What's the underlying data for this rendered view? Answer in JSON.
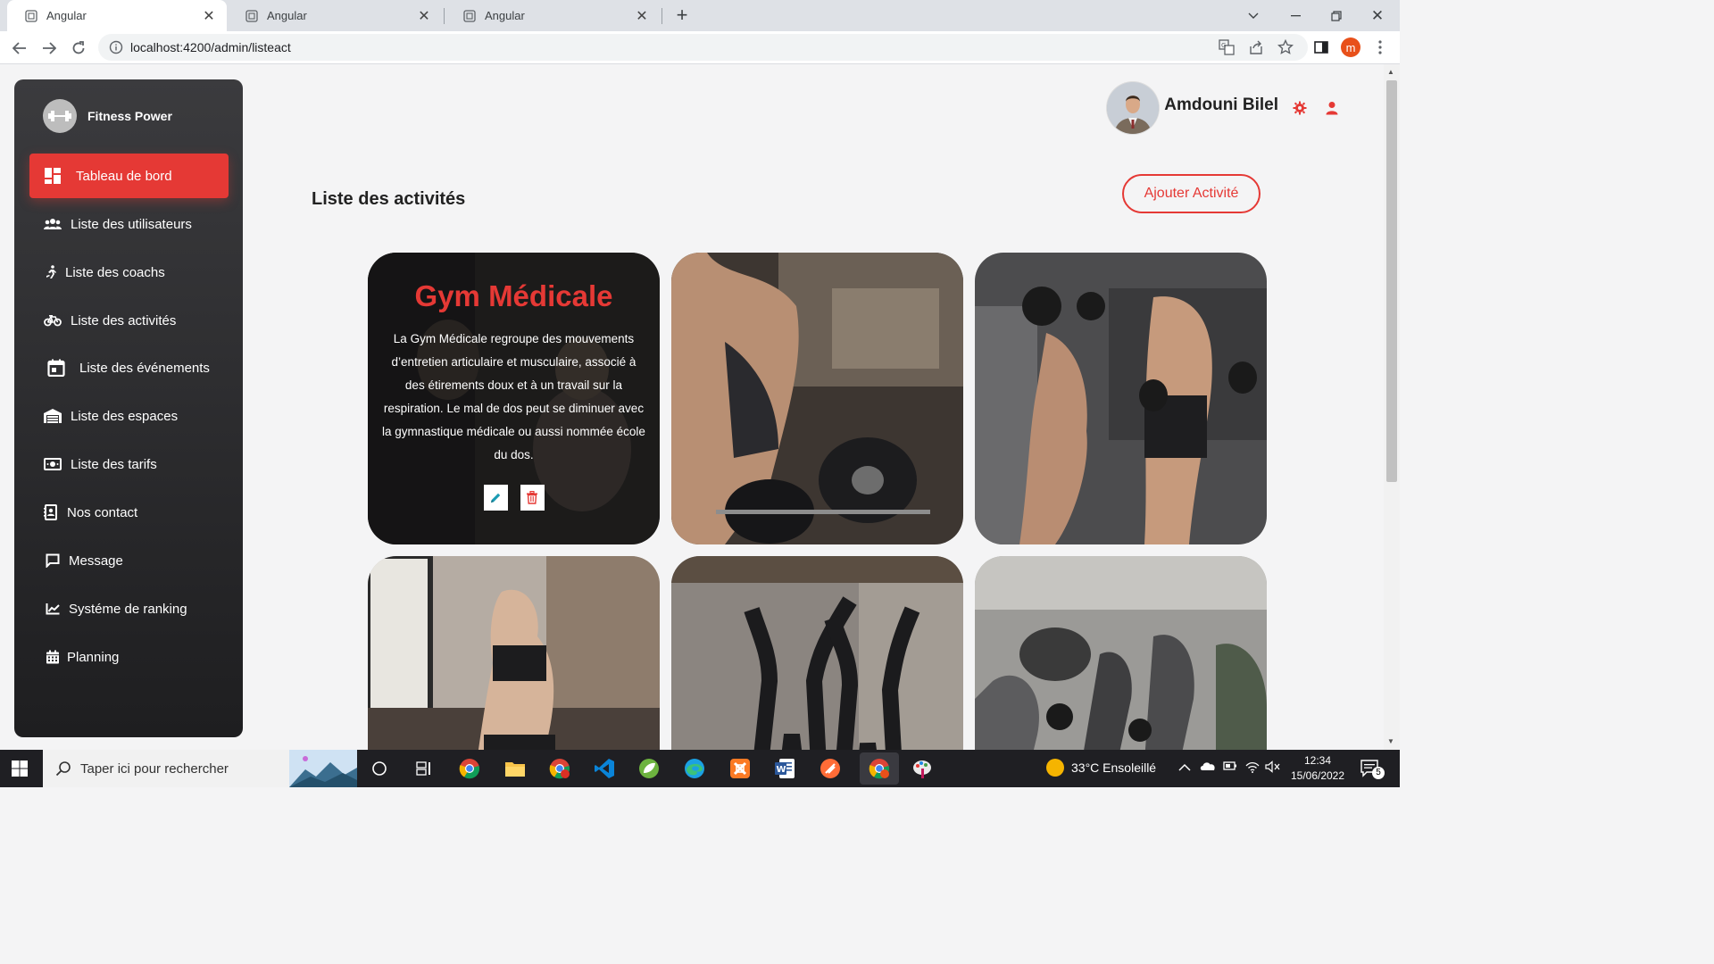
{
  "browser": {
    "tabs": [
      {
        "title": "Angular",
        "active": true
      },
      {
        "title": "Angular",
        "active": false
      },
      {
        "title": "Angular",
        "active": false
      }
    ],
    "url": "localhost:4200/admin/listeact",
    "profile_initial": "m"
  },
  "sidebar": {
    "brand": "Fitness Power",
    "items": [
      {
        "label": "Tableau de bord",
        "icon": "dashboard-icon",
        "active": true
      },
      {
        "label": "Liste des utilisateurs",
        "icon": "users-icon"
      },
      {
        "label": "Liste des coachs",
        "icon": "running-icon"
      },
      {
        "label": "Liste des activités",
        "icon": "bicycle-icon"
      },
      {
        "label": "Liste des événements",
        "icon": "calendar-icon"
      },
      {
        "label": "Liste des espaces",
        "icon": "warehouse-icon"
      },
      {
        "label": "Liste des tarifs",
        "icon": "money-icon"
      },
      {
        "label": "Nos contact",
        "icon": "contact-book-icon"
      },
      {
        "label": "Message",
        "icon": "message-icon"
      },
      {
        "label": "Systéme de ranking",
        "icon": "chart-line-icon"
      },
      {
        "label": "Planning",
        "icon": "calendar-grid-icon"
      }
    ]
  },
  "header": {
    "username": "Amdouni Bilel"
  },
  "main": {
    "title": "Liste des activités",
    "add_button": "Ajouter Activité",
    "featured_card": {
      "title": "Gym Médicale",
      "description": "La Gym Médicale regroupe des mouvements d’entretien articulaire et musculaire, associé à des étirements doux et à un travail sur la respiration. Le mal de dos peut se diminuer avec la gymnastique médicale ou aussi nommée école du dos."
    }
  },
  "taskbar": {
    "search_placeholder": "Taper ici pour rechercher",
    "weather": "33°C  Ensoleillé",
    "time": "12:34",
    "date": "15/06/2022",
    "notifications": "5"
  },
  "colors": {
    "accent": "#e53935",
    "sidebar": "#2c2c2f"
  }
}
